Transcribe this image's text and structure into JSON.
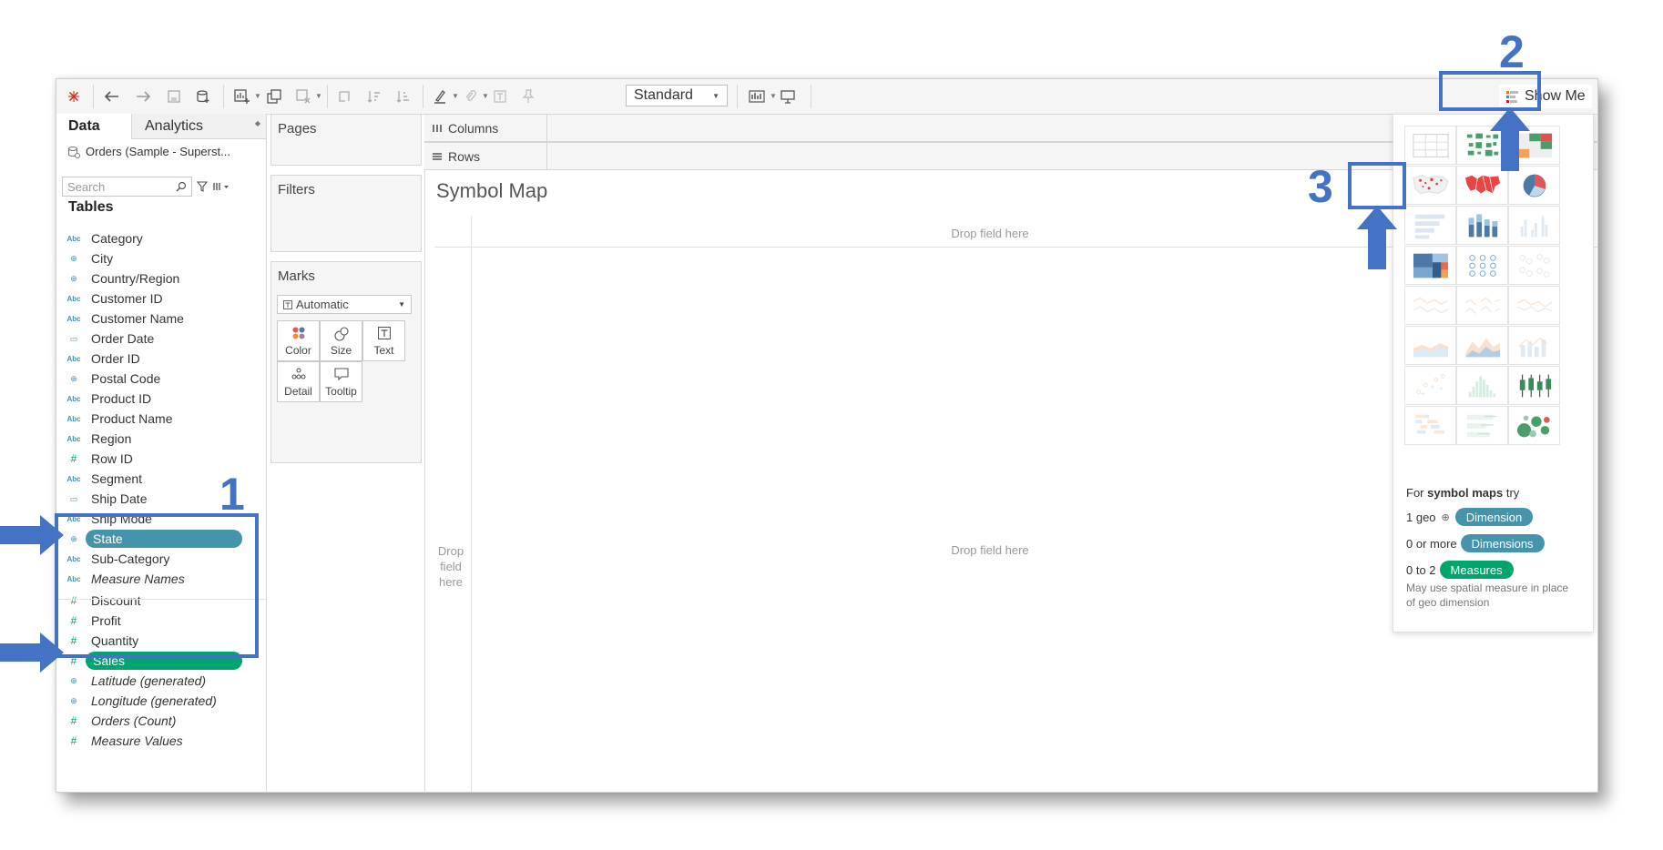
{
  "toolbar": {
    "view_size_select": "Standard",
    "show_me_label": "Show Me"
  },
  "data_pane": {
    "tab_data": "Data",
    "tab_analytics": "Analytics",
    "datasource": "Orders (Sample - Superst...",
    "search_placeholder": "Search",
    "tables_title": "Tables",
    "fields": [
      {
        "name": "Category",
        "type": "abc"
      },
      {
        "name": "City",
        "type": "geo"
      },
      {
        "name": "Country/Region",
        "type": "geo"
      },
      {
        "name": "Customer ID",
        "type": "abc"
      },
      {
        "name": "Customer Name",
        "type": "abc"
      },
      {
        "name": "Order Date",
        "type": "cal"
      },
      {
        "name": "Order ID",
        "type": "abc"
      },
      {
        "name": "Postal Code",
        "type": "geo"
      },
      {
        "name": "Product ID",
        "type": "abc"
      },
      {
        "name": "Product Name",
        "type": "abc"
      },
      {
        "name": "Region",
        "type": "abc"
      },
      {
        "name": "Row ID",
        "type": "hash"
      },
      {
        "name": "Segment",
        "type": "abc"
      },
      {
        "name": "Ship Date",
        "type": "cal"
      },
      {
        "name": "Ship Mode",
        "type": "abc"
      },
      {
        "name": "State",
        "type": "geo",
        "selected": true
      },
      {
        "name": "Sub-Category",
        "type": "abc"
      },
      {
        "name": "Measure Names",
        "type": "abc",
        "italic": true
      },
      {
        "name": "Discount",
        "type": "hash"
      },
      {
        "name": "Profit",
        "type": "hash"
      },
      {
        "name": "Quantity",
        "type": "hash"
      },
      {
        "name": "Sales",
        "type": "hash",
        "selected": true
      },
      {
        "name": "Latitude (generated)",
        "type": "geo",
        "italic": true
      },
      {
        "name": "Longitude (generated)",
        "type": "geo",
        "italic": true
      },
      {
        "name": "Orders (Count)",
        "type": "hash",
        "italic": true
      },
      {
        "name": "Measure Values",
        "type": "hash",
        "italic": true
      }
    ]
  },
  "cards": {
    "pages": "Pages",
    "filters": "Filters",
    "marks": "Marks",
    "marks_type": "Automatic",
    "mark_buttons": [
      "Color",
      "Size",
      "Text",
      "Detail",
      "Tooltip"
    ]
  },
  "shelves": {
    "columns": "Columns",
    "rows": "Rows"
  },
  "view": {
    "title": "Symbol Map",
    "drop_top": "Drop field here",
    "drop_left": "Drop field here",
    "drop_center": "Drop field here"
  },
  "show_me": {
    "hint_prefix": "For ",
    "hint_bold": "symbol maps",
    "hint_suffix": " try",
    "row1_prefix": "1 geo",
    "row1_pill": "Dimension",
    "row2_prefix": "0 or more",
    "row2_pill": "Dimensions",
    "row3_prefix": "0 to 2",
    "row3_pill": "Measures",
    "note": "May use spatial measure in place of geo dimension"
  },
  "annotations": {
    "step1": "1",
    "step2": "2",
    "step3": "3"
  },
  "colors": {
    "dimension": "#4694ac",
    "measure": "#00a46f",
    "annotation": "#4472c4"
  }
}
